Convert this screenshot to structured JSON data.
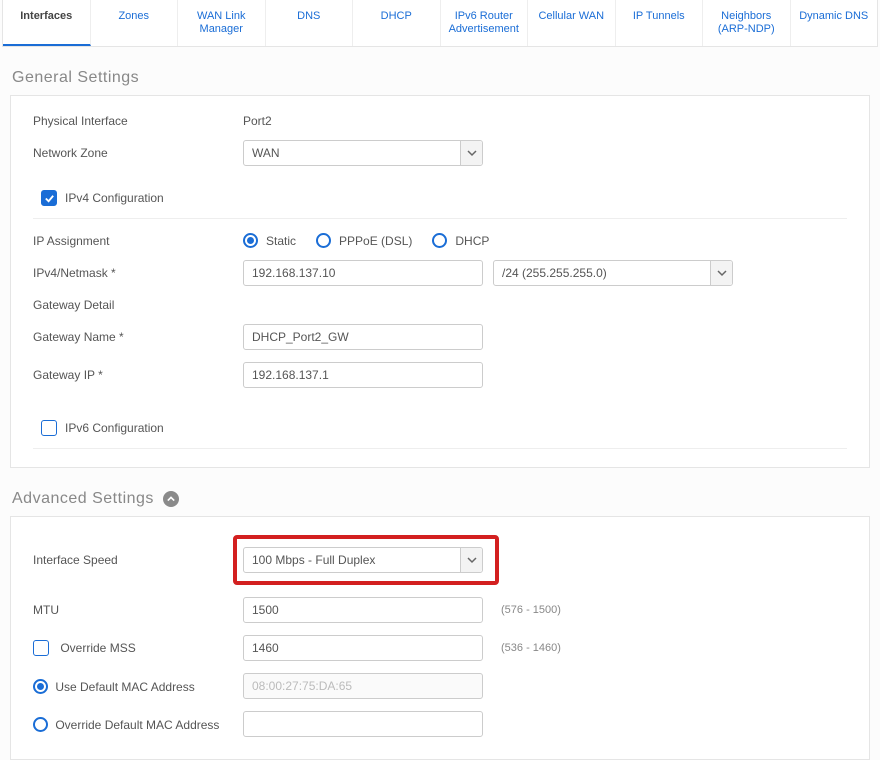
{
  "tabs": {
    "t0": "Interfaces",
    "t1": "Zones",
    "t2": "WAN Link Manager",
    "t3": "DNS",
    "t4": "DHCP",
    "t5": "IPv6 Router Advertisement",
    "t6": "Cellular WAN",
    "t7": "IP Tunnels",
    "t8": "Neighbors (ARP-NDP)",
    "t9": "Dynamic DNS"
  },
  "sections": {
    "general": "General Settings",
    "advanced": "Advanced Settings"
  },
  "general": {
    "phys_if_label": "Physical Interface",
    "phys_if_value": "Port2",
    "zone_label": "Network Zone",
    "zone_value": "WAN",
    "ipv4_conf_label": "IPv4 Configuration",
    "ip_assign_label": "IP Assignment",
    "assign_static": "Static",
    "assign_pppoe": "PPPoE (DSL)",
    "assign_dhcp": "DHCP",
    "netmask_label": "IPv4/Netmask *",
    "netmask_ip": "192.168.137.10",
    "netmask_mask": "/24 (255.255.255.0)",
    "gw_detail_label": "Gateway Detail",
    "gw_name_label": "Gateway Name *",
    "gw_name_value": "DHCP_Port2_GW",
    "gw_ip_label": "Gateway IP *",
    "gw_ip_value": "192.168.137.1",
    "ipv6_conf_label": "IPv6 Configuration"
  },
  "advanced": {
    "speed_label": "Interface Speed",
    "speed_value": "100 Mbps - Full Duplex",
    "mtu_label": "MTU",
    "mtu_value": "1500",
    "mtu_hint": "(576 - 1500)",
    "mss_label": "Override MSS",
    "mss_value": "1460",
    "mss_hint": "(536 - 1460)",
    "mac_default_label": "Use Default MAC Address",
    "mac_default_value": "08:00:27:75:DA:65",
    "mac_override_label": "Override Default MAC Address"
  }
}
